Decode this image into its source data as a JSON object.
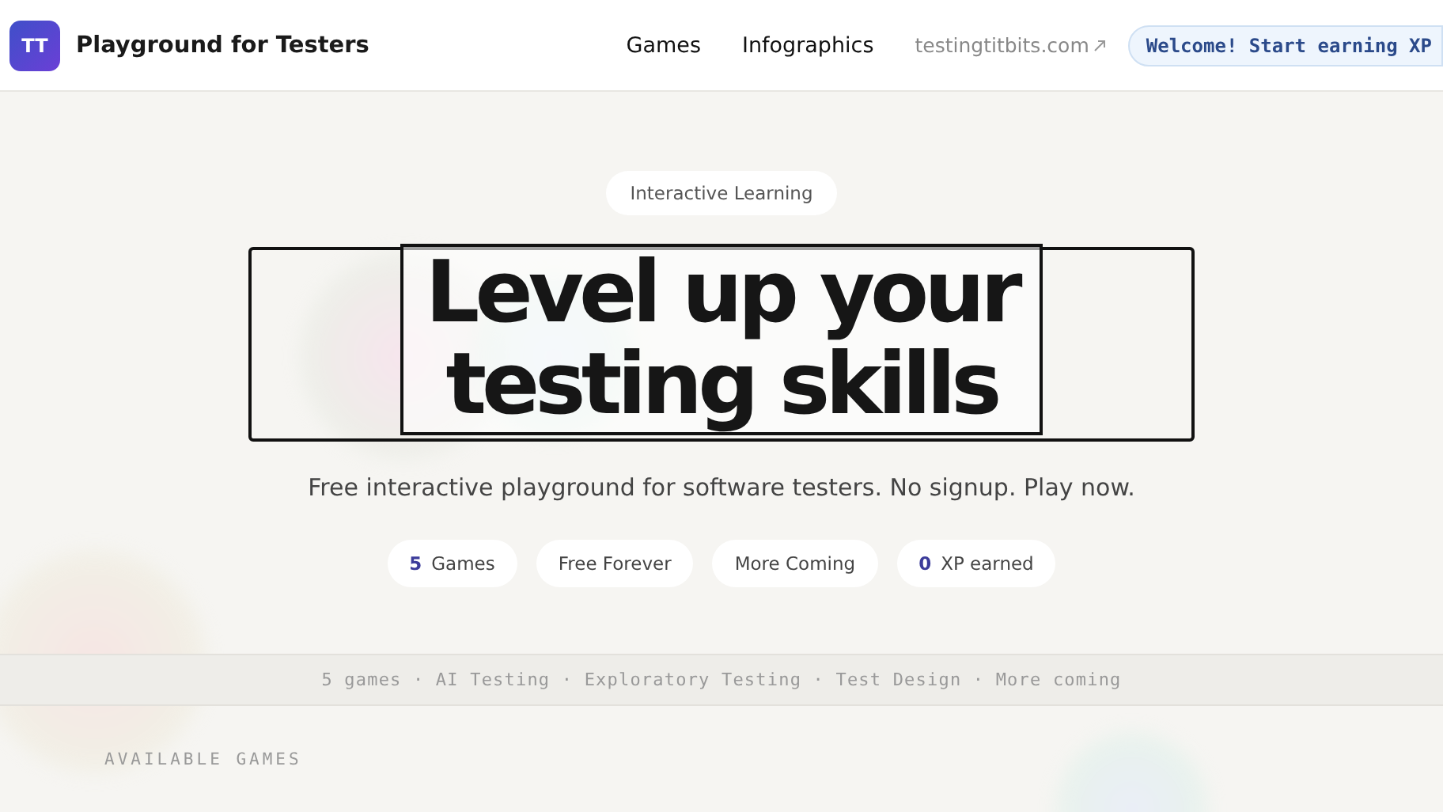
{
  "header": {
    "logo": "TT",
    "title": "Playground for Testers",
    "nav": [
      {
        "label": "Games",
        "kind": "nav"
      },
      {
        "label": "Infographics",
        "kind": "nav"
      },
      {
        "label": "testingtitbits.com",
        "kind": "external"
      }
    ],
    "welcome": "Welcome! Start earning XP"
  },
  "hero": {
    "badge": "Interactive Learning",
    "headline": [
      "Level up your",
      "testing skills"
    ],
    "subtitle": "Free interactive playground for software testers. No signup. Play now.",
    "stats": [
      {
        "count": "5",
        "label": "Games"
      },
      {
        "label": "Free Forever"
      },
      {
        "label": "More Coming"
      },
      {
        "count": "0",
        "label": "XP earned"
      }
    ]
  },
  "ticker": "5 games · AI Testing · Exploratory Testing · Test Design · More coming",
  "section_title": "AVAILABLE GAMES"
}
